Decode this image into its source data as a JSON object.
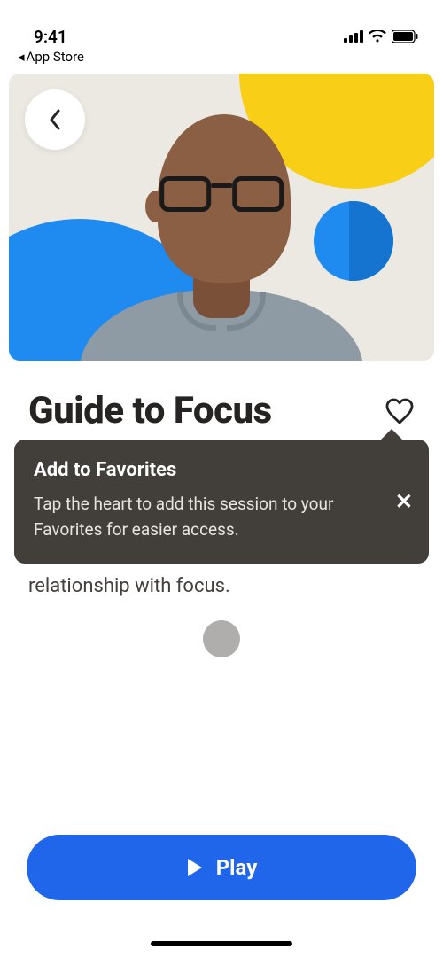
{
  "status": {
    "time": "9:41",
    "back_app_label": "App Store"
  },
  "hero": {
    "back_icon": "chevron-left"
  },
  "session": {
    "title": "Guide to Focus",
    "favorite_icon": "heart-outline",
    "description_visible_tail": "relationship with focus."
  },
  "tooltip": {
    "title": "Add to Favorites",
    "body": "Tap the heart to add this session to your Favorites for easier access.",
    "close_label": "✕"
  },
  "cta": {
    "play_label": "Play"
  }
}
